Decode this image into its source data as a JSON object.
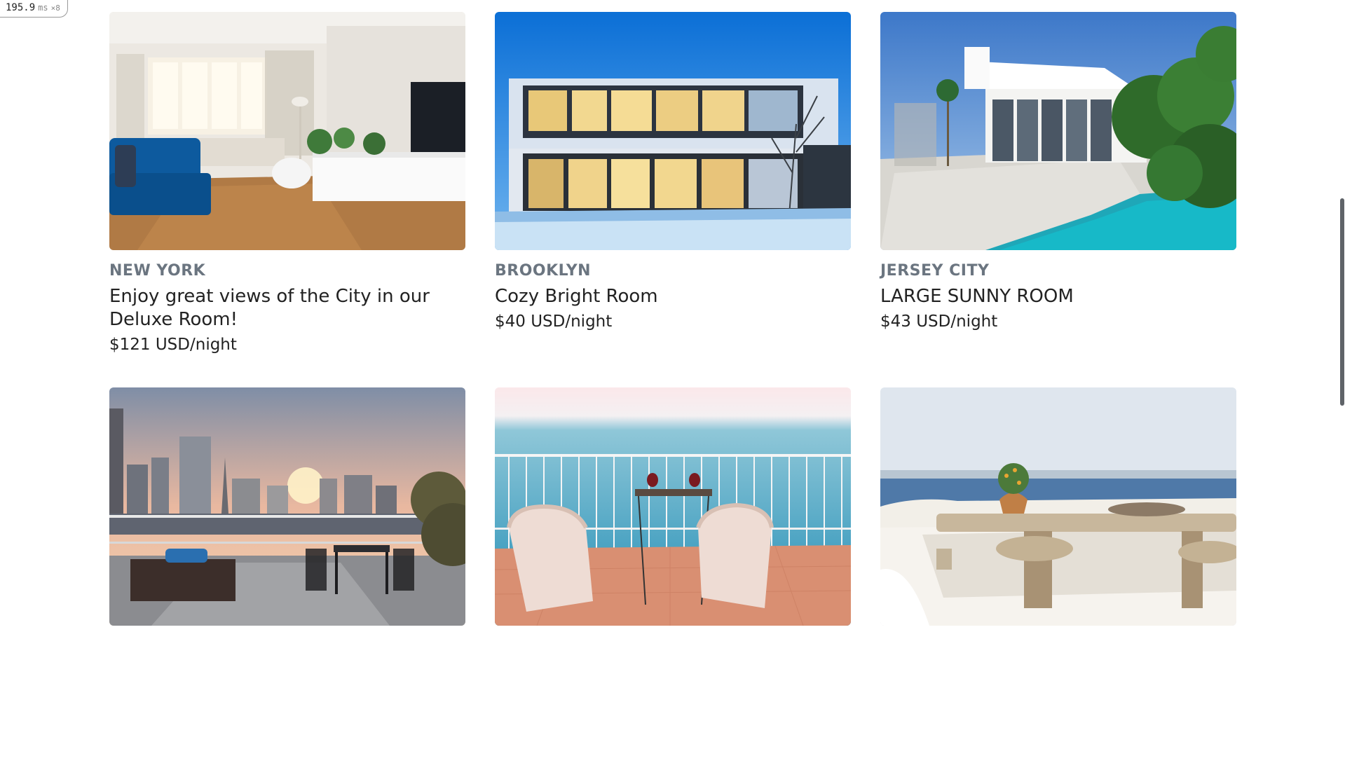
{
  "perf": {
    "value": "195.9",
    "unit": "ms",
    "multiplier": "×8"
  },
  "listings": [
    {
      "location": "NEW YORK",
      "title": "Enjoy great views of the City in our Deluxe Room!",
      "price": "$121 USD/night",
      "image": "living-room-photo"
    },
    {
      "location": "BROOKLYN",
      "title": "Cozy Bright Room",
      "price": "$40 USD/night",
      "image": "modern-house-photo"
    },
    {
      "location": "JERSEY CITY",
      "title": "LARGE SUNNY ROOM",
      "price": "$43 USD/night",
      "image": "pool-villa-photo"
    },
    {
      "location": "",
      "title": "",
      "price": "",
      "image": "rooftop-terrace-photo"
    },
    {
      "location": "",
      "title": "",
      "price": "",
      "image": "sea-balcony-photo"
    },
    {
      "location": "",
      "title": "",
      "price": "",
      "image": "santorini-terrace-photo"
    }
  ]
}
